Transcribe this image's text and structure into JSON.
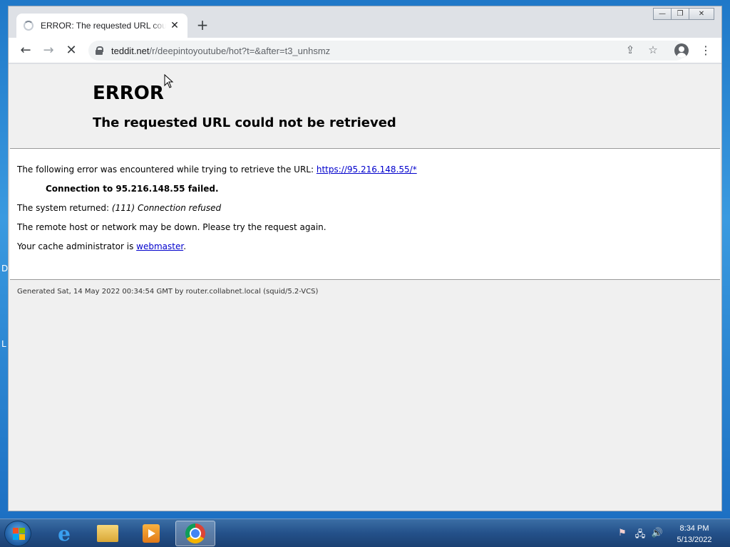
{
  "browser": {
    "tab_title": "ERROR: The requested URL could not be retrieved",
    "tab_close": "✕",
    "new_tab": "+",
    "window_controls": {
      "minimize": "—",
      "restore": "❐",
      "close": "✕"
    },
    "nav": {
      "back": "←",
      "forward": "→",
      "stop": "✕"
    },
    "url_host": "teddit.net",
    "url_path": "/r/deepintoyoutube/hot?t=&after=t3_unhsmz",
    "share_icon": "⇪",
    "star_icon": "☆",
    "menu_icon": "⋮"
  },
  "page": {
    "title": "ERROR",
    "subtitle": "The requested URL could not be retrieved",
    "line1_prefix": "The following error was encountered while trying to retrieve the URL: ",
    "line1_link": "https://95.216.148.55/*",
    "line2": "Connection to 95.216.148.55 failed.",
    "line3_prefix": "The system returned: ",
    "line3_em": "(111) Connection refused",
    "line4": "The remote host or network may be down. Please try the request again.",
    "line5_prefix": "Your cache administrator is ",
    "line5_link": "webmaster",
    "line5_suffix": ".",
    "footer": "Generated Sat, 14 May 2022 00:34:54 GMT by router.collabnet.local (squid/5.2-VCS)"
  },
  "desktop": {
    "glyph_d": "D",
    "glyph_l": "L"
  },
  "taskbar": {
    "items": [
      "start-button",
      "internet-explorer",
      "windows-explorer",
      "media-player",
      "google-chrome"
    ],
    "tray_flag": "⚑",
    "tray_network": "🖧",
    "tray_volume": "🔊",
    "time": "8:34 PM",
    "date": "5/13/2022"
  }
}
